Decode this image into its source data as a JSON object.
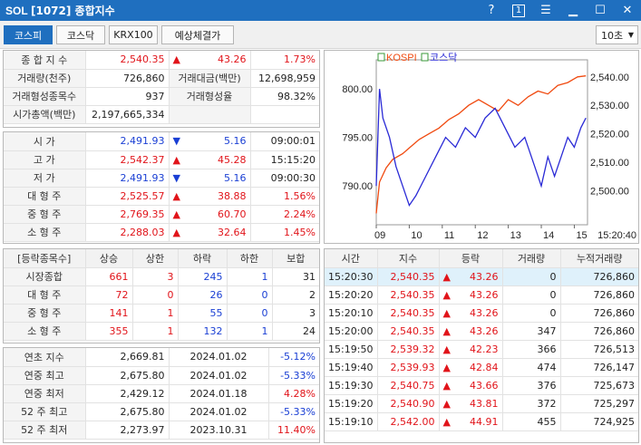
{
  "window": {
    "logo": "SOL",
    "title": "[1072] 종합지수",
    "help": "?",
    "box_num": "1"
  },
  "toolbar": {
    "tabs": [
      "코스피",
      "코스닥",
      "KRX100",
      "예상체결가"
    ],
    "interval": "10초"
  },
  "summary": {
    "rows": [
      {
        "label": "종 합 지 수",
        "value": "2,540.35",
        "arrow": "▲",
        "change": "43.26",
        "rate": "1.73%"
      },
      {
        "label": "거래량(천주)",
        "value": "726,860",
        "label2": "거래대금(백만)",
        "value2": "12,698,959"
      },
      {
        "label": "거래형성종목수",
        "value": "937",
        "label2": "거래형성율",
        "value2": "98.32%"
      },
      {
        "label": "시가총액(백만)",
        "value": "2,197,665,334"
      }
    ]
  },
  "ohlc": {
    "rows": [
      {
        "label": "시 가",
        "value": "2,491.93",
        "arrow": "▼",
        "change": "5.16",
        "time": "09:00:01",
        "dir": "down"
      },
      {
        "label": "고 가",
        "value": "2,542.37",
        "arrow": "▲",
        "change": "45.28",
        "time": "15:15:20",
        "dir": "up"
      },
      {
        "label": "저 가",
        "value": "2,491.93",
        "arrow": "▼",
        "change": "5.16",
        "time": "09:00:30",
        "dir": "down"
      },
      {
        "label": "대 형 주",
        "value": "2,525.57",
        "arrow": "▲",
        "change": "38.88",
        "time": "1.56%",
        "dir": "up"
      },
      {
        "label": "중 형 주",
        "value": "2,769.35",
        "arrow": "▲",
        "change": "60.70",
        "time": "2.24%",
        "dir": "up"
      },
      {
        "label": "소 형 주",
        "value": "2,288.03",
        "arrow": "▲",
        "change": "32.64",
        "time": "1.45%",
        "dir": "up"
      }
    ]
  },
  "breadth": {
    "headers": [
      "[등락종목수]",
      "상승",
      "상한",
      "하락",
      "하한",
      "보합"
    ],
    "rows": [
      {
        "label": "시장종합",
        "up": "661",
        "upper": "3",
        "down": "245",
        "lower": "1",
        "flat": "31"
      },
      {
        "label": "대 형 주",
        "up": "72",
        "upper": "0",
        "down": "26",
        "lower": "0",
        "flat": "2"
      },
      {
        "label": "중 형 주",
        "up": "141",
        "upper": "1",
        "down": "55",
        "lower": "0",
        "flat": "3"
      },
      {
        "label": "소 형 주",
        "up": "355",
        "upper": "1",
        "down": "132",
        "lower": "1",
        "flat": "24"
      }
    ]
  },
  "extremes": {
    "rows": [
      {
        "label": "연초 지수",
        "value": "2,669.81",
        "date": "2024.01.02",
        "rate": "-5.12%",
        "dir": "down"
      },
      {
        "label": "연중 최고",
        "value": "2,675.80",
        "date": "2024.01.02",
        "rate": "-5.33%",
        "dir": "down"
      },
      {
        "label": "연중 최저",
        "value": "2,429.12",
        "date": "2024.01.18",
        "rate": "4.28%",
        "dir": "up"
      },
      {
        "label": "52 주 최고",
        "value": "2,675.80",
        "date": "2024.01.02",
        "rate": "-5.33%",
        "dir": "down"
      },
      {
        "label": "52 주 최저",
        "value": "2,273.97",
        "date": "2023.10.31",
        "rate": "11.40%",
        "dir": "up"
      }
    ]
  },
  "ticks": {
    "headers": [
      "시간",
      "지수",
      "등락",
      "거래량",
      "누적거래량"
    ],
    "rows": [
      {
        "time": "15:20:30",
        "index": "2,540.35",
        "arrow": "▲",
        "change": "43.26",
        "vol": "0",
        "cum": "726,860"
      },
      {
        "time": "15:20:20",
        "index": "2,540.35",
        "arrow": "▲",
        "change": "43.26",
        "vol": "0",
        "cum": "726,860"
      },
      {
        "time": "15:20:10",
        "index": "2,540.35",
        "arrow": "▲",
        "change": "43.26",
        "vol": "0",
        "cum": "726,860"
      },
      {
        "time": "15:20:00",
        "index": "2,540.35",
        "arrow": "▲",
        "change": "43.26",
        "vol": "347",
        "cum": "726,860"
      },
      {
        "time": "15:19:50",
        "index": "2,539.32",
        "arrow": "▲",
        "change": "42.23",
        "vol": "366",
        "cum": "726,513"
      },
      {
        "time": "15:19:40",
        "index": "2,539.93",
        "arrow": "▲",
        "change": "42.84",
        "vol": "474",
        "cum": "726,147"
      },
      {
        "time": "15:19:30",
        "index": "2,540.75",
        "arrow": "▲",
        "change": "43.66",
        "vol": "376",
        "cum": "725,673"
      },
      {
        "time": "15:19:20",
        "index": "2,540.90",
        "arrow": "▲",
        "change": "43.81",
        "vol": "372",
        "cum": "725,297"
      },
      {
        "time": "15:19:10",
        "index": "2,542.00",
        "arrow": "▲",
        "change": "44.91",
        "vol": "455",
        "cum": "724,925"
      }
    ]
  },
  "colors": {
    "titlebar": "#1f6fbf",
    "up": "#e1141a",
    "down": "#1a3fd4",
    "kospi_line": "#f04a10",
    "kosdaq_line": "#2a2ad6"
  },
  "chart_data": {
    "type": "line",
    "legend": [
      "KOSPI",
      "코스닥"
    ],
    "legend_position": "top-left",
    "x_ticks": [
      "09",
      "10",
      "11",
      "12",
      "13",
      "14",
      "15",
      "15:20:40"
    ],
    "y_left": {
      "ticks": [
        "800.00",
        "795.00",
        "790.00"
      ],
      "range": [
        786,
        803
      ]
    },
    "y_right": {
      "ticks": [
        "2,540.00",
        "2,530.00",
        "2,520.00",
        "2,510.00",
        "2,500.00"
      ],
      "range": [
        2488,
        2546
      ]
    },
    "series": [
      {
        "name": "KOSPI",
        "axis": "right",
        "x": [
          9.0,
          9.1,
          9.3,
          9.5,
          9.8,
          10.0,
          10.3,
          10.6,
          10.9,
          11.2,
          11.5,
          11.8,
          12.1,
          12.4,
          12.7,
          13.0,
          13.3,
          13.6,
          13.9,
          14.2,
          14.5,
          14.8,
          15.1,
          15.35
        ],
        "values": [
          2492,
          2503,
          2508,
          2511,
          2513,
          2515,
          2518,
          2520,
          2522,
          2525,
          2527,
          2530,
          2532,
          2530,
          2528,
          2532,
          2530,
          2533,
          2535,
          2534,
          2537,
          2538,
          2540,
          2540.35
        ]
      },
      {
        "name": "코스닥",
        "axis": "left",
        "x": [
          9.0,
          9.1,
          9.2,
          9.4,
          9.6,
          9.8,
          10.0,
          10.2,
          10.5,
          10.8,
          11.1,
          11.4,
          11.7,
          12.0,
          12.3,
          12.6,
          12.9,
          13.2,
          13.5,
          13.8,
          14.0,
          14.2,
          14.4,
          14.6,
          14.8,
          15.0,
          15.2,
          15.35
        ],
        "values": [
          790,
          800,
          797,
          795,
          792,
          790,
          788,
          789,
          791,
          793,
          795,
          794,
          796,
          795,
          797,
          798,
          796,
          794,
          795,
          792,
          790,
          793,
          791,
          793,
          795,
          794,
          796,
          797
        ]
      }
    ]
  }
}
